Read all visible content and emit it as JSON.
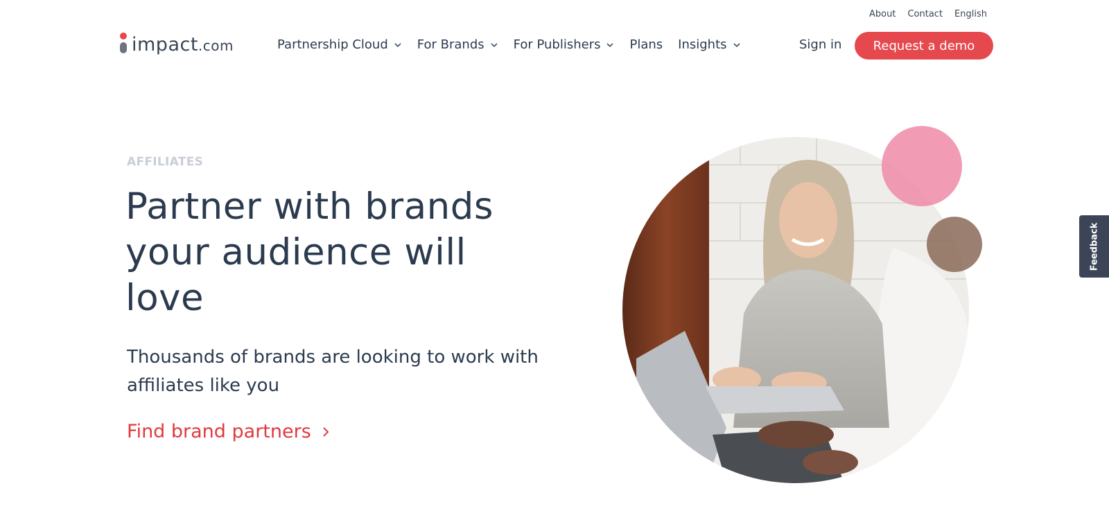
{
  "utility_nav": {
    "about": "About",
    "contact": "Contact",
    "language": "English"
  },
  "logo": {
    "name": "impact",
    "tld": ".com"
  },
  "nav": {
    "items": [
      {
        "label": "Partnership Cloud",
        "has_dropdown": true
      },
      {
        "label": "For Brands",
        "has_dropdown": true
      },
      {
        "label": "For Publishers",
        "has_dropdown": true
      },
      {
        "label": "Plans",
        "has_dropdown": false
      },
      {
        "label": "Insights",
        "has_dropdown": true
      }
    ],
    "sign_in": "Sign in",
    "demo_button": "Request a demo"
  },
  "hero": {
    "eyebrow": "AFFILIATES",
    "headline": "Partner with brands your audience will love",
    "subhead": "Thousands of brands are looking to work with affiliates like you",
    "cta": "Find brand partners"
  },
  "feedback_tab": "Feedback",
  "icons": {
    "dropdown": "chevron-down-icon",
    "cta_arrow": "chevron-right-icon"
  },
  "colors": {
    "accent_red": "#e5484d",
    "link_red": "#e03a3e",
    "text_dark": "#2b3a4e",
    "eyebrow_gray": "#c9ced6",
    "logo_gray": "#6b7280",
    "bubble_pink": "#ee8aa8",
    "bubble_brown": "#8a6a58"
  }
}
